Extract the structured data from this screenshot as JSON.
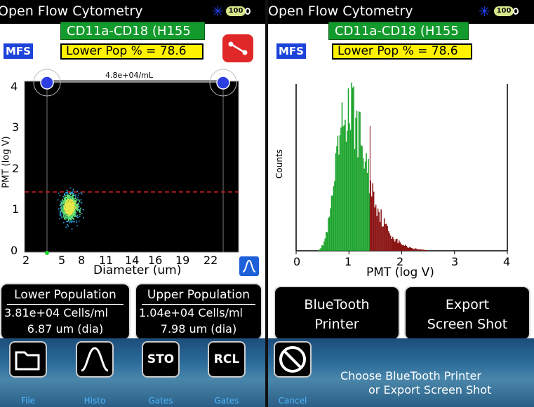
{
  "left": {
    "app_title": "Open Flow Cytometry",
    "battery": "100",
    "sample_name": "CD11a-CD18 (H155",
    "mode_badge": "MFS",
    "lower_pop_label": "Lower Pop % = 78.6",
    "concentration": "4.8e+04/mL",
    "plot": {
      "y_ticks": [
        "4",
        "3",
        "2",
        "1",
        "0"
      ],
      "x_ticks": [
        "2",
        "5",
        "8",
        "11",
        "14",
        "16",
        "19",
        "22"
      ],
      "xlabel": "Diameter (um)",
      "ylabel": "PMT (log V)"
    },
    "lower_population": {
      "title": "Lower Population",
      "cells": "3.81e+04 Cells/ml",
      "dia": "6.87 um   (dia)"
    },
    "upper_population": {
      "title": "Upper Population",
      "cells": "1.04e+04 Cells/ml",
      "dia": "7.98 um   (dia)"
    },
    "toolbar": [
      {
        "label": "",
        "caption": "File"
      },
      {
        "label": "",
        "caption": "Histo"
      },
      {
        "label": "STO",
        "caption": "Gates"
      },
      {
        "label": "RCL",
        "caption": "Gates"
      }
    ]
  },
  "right": {
    "app_title": "Open Flow Cytometry",
    "battery": "100",
    "sample_name": "CD11a-CD18 (H155",
    "mode_badge": "MFS",
    "lower_pop_label": "Lower Pop % = 78.6",
    "chart_data": {
      "type": "bar",
      "xlabel": "PMT (log V)",
      "ylabel": "Counts",
      "x_ticks": [
        "0",
        "1",
        "2",
        "3",
        "4"
      ],
      "xlim": [
        0,
        4
      ],
      "gate": 1.4,
      "lower_color": "#1aa32a",
      "upper_color": "#8b1414"
    },
    "bluetooth_printer_label": [
      "BlueTooth",
      "Printer"
    ],
    "export_label": [
      "Export",
      "Screen Shot"
    ],
    "cancel_caption": "Cancel",
    "status_line1": "Choose BlueTooth Printer",
    "status_line2": "or Export Screen Shot"
  },
  "colors": {
    "accent_green": "#139a2c",
    "mfs_blue": "#1d44d8",
    "highlight_yellow": "#fff200",
    "gate_red": "#e02828"
  }
}
